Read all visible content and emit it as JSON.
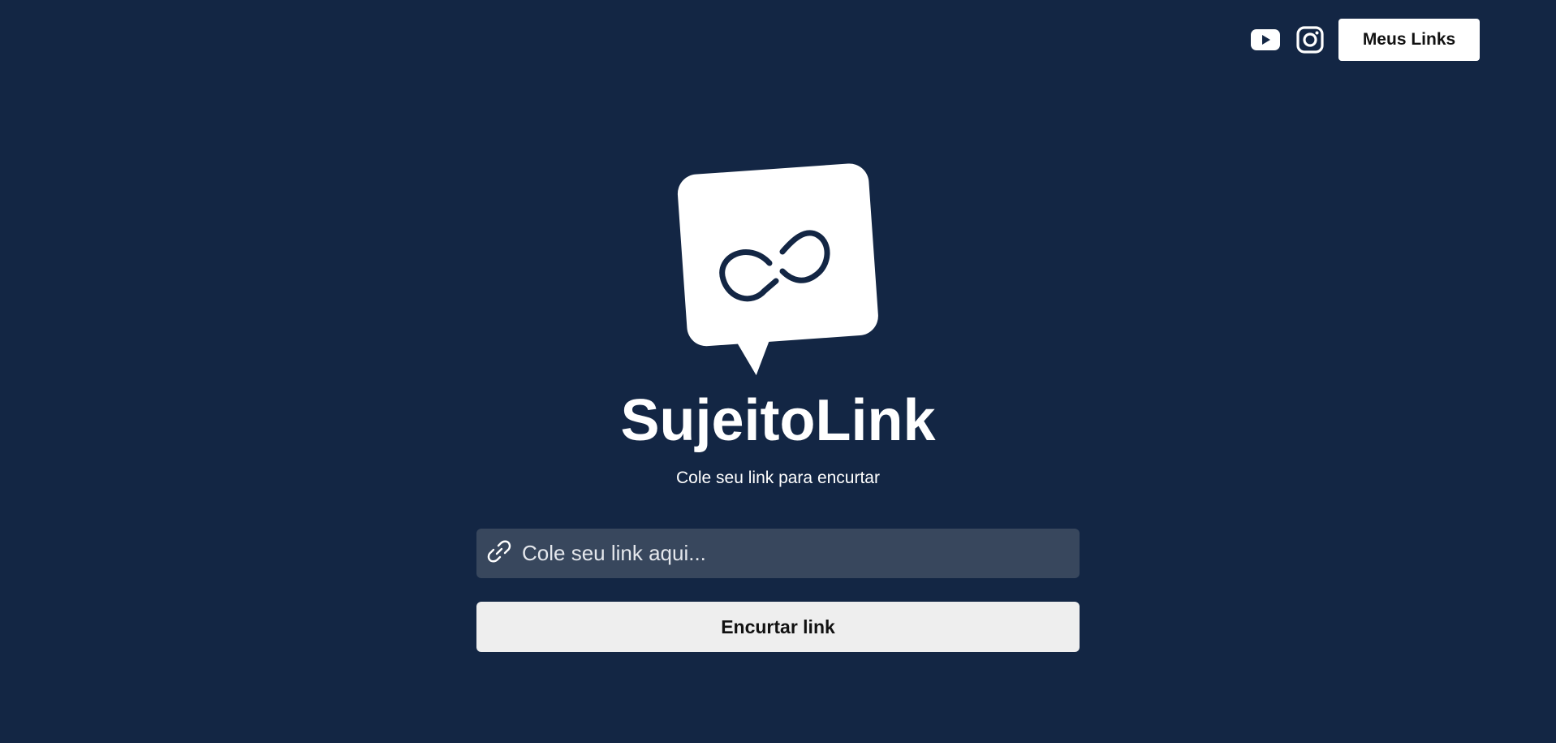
{
  "header": {
    "social": [
      {
        "icon": "youtube-icon"
      },
      {
        "icon": "instagram-icon"
      }
    ],
    "my_links_label": "Meus Links"
  },
  "main": {
    "logo_icon": "link-chat-bubble-logo",
    "title": "SujeitoLink",
    "subtitle": "Cole seu link para encurtar",
    "input": {
      "icon": "link-icon",
      "placeholder": "Cole seu link aqui...",
      "value": ""
    },
    "shorten_button_label": "Encurtar link"
  },
  "colors": {
    "background": "#132644",
    "input_background": "#38475d",
    "button_background": "#eeeeee",
    "text": "#ffffff"
  }
}
